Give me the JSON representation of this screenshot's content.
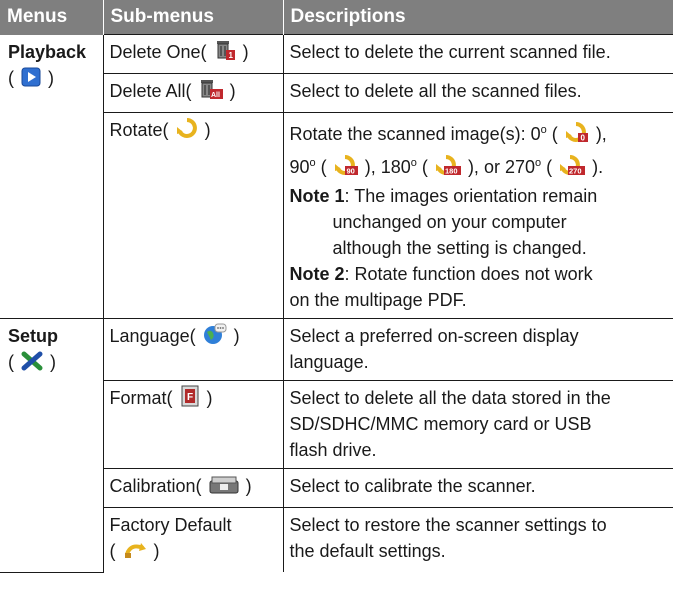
{
  "headers": [
    "Menus",
    "Sub-menus",
    "Descriptions"
  ],
  "playback": {
    "menu": "Playback",
    "icon": "play-icon",
    "rows": [
      {
        "sub": "Delete One(",
        "sub_icon": "trash-one-icon",
        "desc": "Select to delete the current scanned file."
      },
      {
        "sub": "Delete All(",
        "sub_icon": "trash-all-icon",
        "desc": "Select to delete all the scanned files."
      },
      {
        "sub": "Rotate(",
        "sub_icon": "rotate-icon"
      }
    ],
    "rotate": {
      "desc_a": "Rotate the scanned image(s): 0",
      "deg": "o",
      "desc_b": "90",
      "desc_c": "180",
      "desc_d": "or 270",
      "note1_label": "Note 1",
      "note1_l1": ": The images orientation remain",
      "note1_l2": "unchanged on your computer",
      "note1_l3": "although the setting is changed.",
      "note2_label": "Note 2",
      "note2_l1": ": Rotate function does not work",
      "note2_l2": "on the multipage PDF."
    }
  },
  "setup": {
    "menu": "Setup",
    "icon": "tools-icon",
    "rows": [
      {
        "sub": "Language(",
        "sub_icon": "globe-icon",
        "desc_l1": "Select a preferred on-screen display",
        "desc_l2": "language."
      },
      {
        "sub": "Format(",
        "sub_icon": "format-icon",
        "desc_l1": "Select to delete all the data stored in the",
        "desc_l2": "SD/SDHC/MMC memory card or USB",
        "desc_l3": "flash drive."
      },
      {
        "sub": "Calibration(",
        "sub_icon": "scanner-icon",
        "desc": "Select to calibrate the scanner."
      },
      {
        "sub_l1": "Factory Default",
        "sub_l2": "(",
        "sub_icon": "reset-icon",
        "desc_l1": "Select to restore the scanner settings to",
        "desc_l2": "the default settings."
      }
    ]
  },
  "punct": {
    "close": ")",
    "close_comma": "),",
    "close_dot": ").",
    "open": "("
  }
}
